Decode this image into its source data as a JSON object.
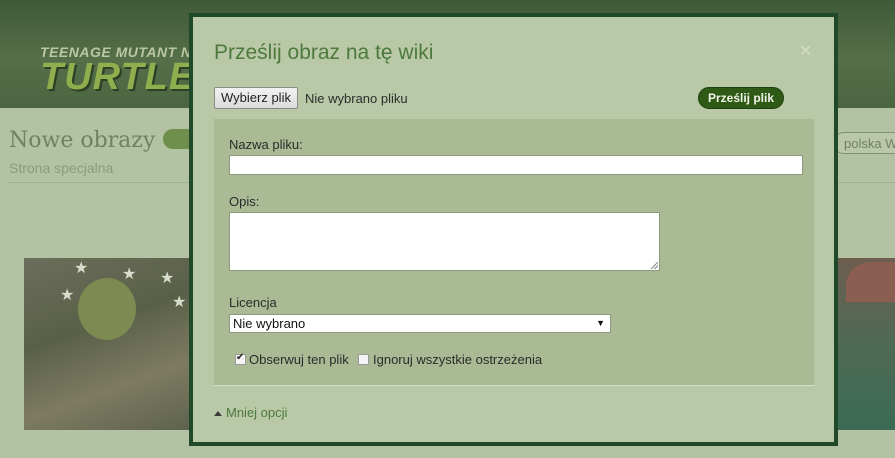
{
  "background": {
    "logo_top": "TEENAGE MUTANT NINJA",
    "logo_main": "TURTLES",
    "page_title": "Nowe obrazy",
    "page_subtitle": "Strona specjalna",
    "language_pill": "polska Wiki"
  },
  "modal": {
    "title": "Prześlij obraz na tę wiki",
    "close_icon": "close-icon",
    "file_button": "Wybierz plik",
    "file_status": "Nie wybrano pliku",
    "upload_button": "Prześlij plik",
    "filename_label": "Nazwa pliku:",
    "filename_value": "",
    "description_label": "Opis:",
    "description_value": "",
    "license_label": "Licencja",
    "license_selected": "Nie wybrano",
    "watch_label": "Obserwuj ten plik",
    "watch_checked": true,
    "ignore_warnings_label": "Ignoruj wszystkie ostrzeżenia",
    "ignore_warnings_checked": false,
    "less_options_label": "Mniej opcji",
    "less_options_icon": "triangle-up-icon"
  },
  "colors": {
    "modal_border": "#1f4a2a",
    "modal_background": "#b9c8a7",
    "title_color": "#4d7a3c",
    "upload_button": "#2f5a16"
  }
}
